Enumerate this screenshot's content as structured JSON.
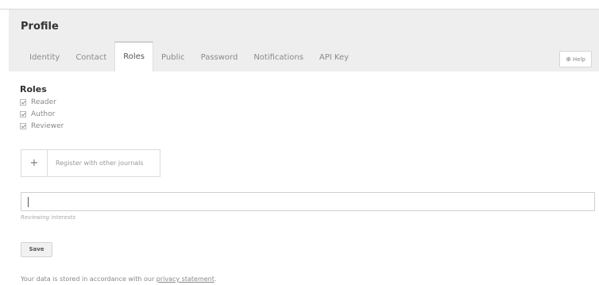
{
  "header": {
    "title": "Profile",
    "help_label": "Help"
  },
  "tabs": [
    {
      "label": "Identity"
    },
    {
      "label": "Contact"
    },
    {
      "label": "Roles"
    },
    {
      "label": "Public"
    },
    {
      "label": "Password"
    },
    {
      "label": "Notifications"
    },
    {
      "label": "API Key"
    }
  ],
  "active_tab": "Roles",
  "roles": {
    "heading": "Roles",
    "items": [
      {
        "label": "Reader",
        "checked": true
      },
      {
        "label": "Author",
        "checked": true
      },
      {
        "label": "Reviewer",
        "checked": true
      }
    ]
  },
  "register": {
    "label": "Register with other journals",
    "icon": "plus-icon"
  },
  "reviewing_interests": {
    "value": "",
    "label": "Reviewing interests"
  },
  "save_label": "Save",
  "privacy": {
    "prefix": "Your data is stored in accordance with our ",
    "link": "privacy statement",
    "suffix": "."
  },
  "colors": {
    "header_bg": "#eeeeee",
    "text": "#444444",
    "muted": "#888888"
  }
}
